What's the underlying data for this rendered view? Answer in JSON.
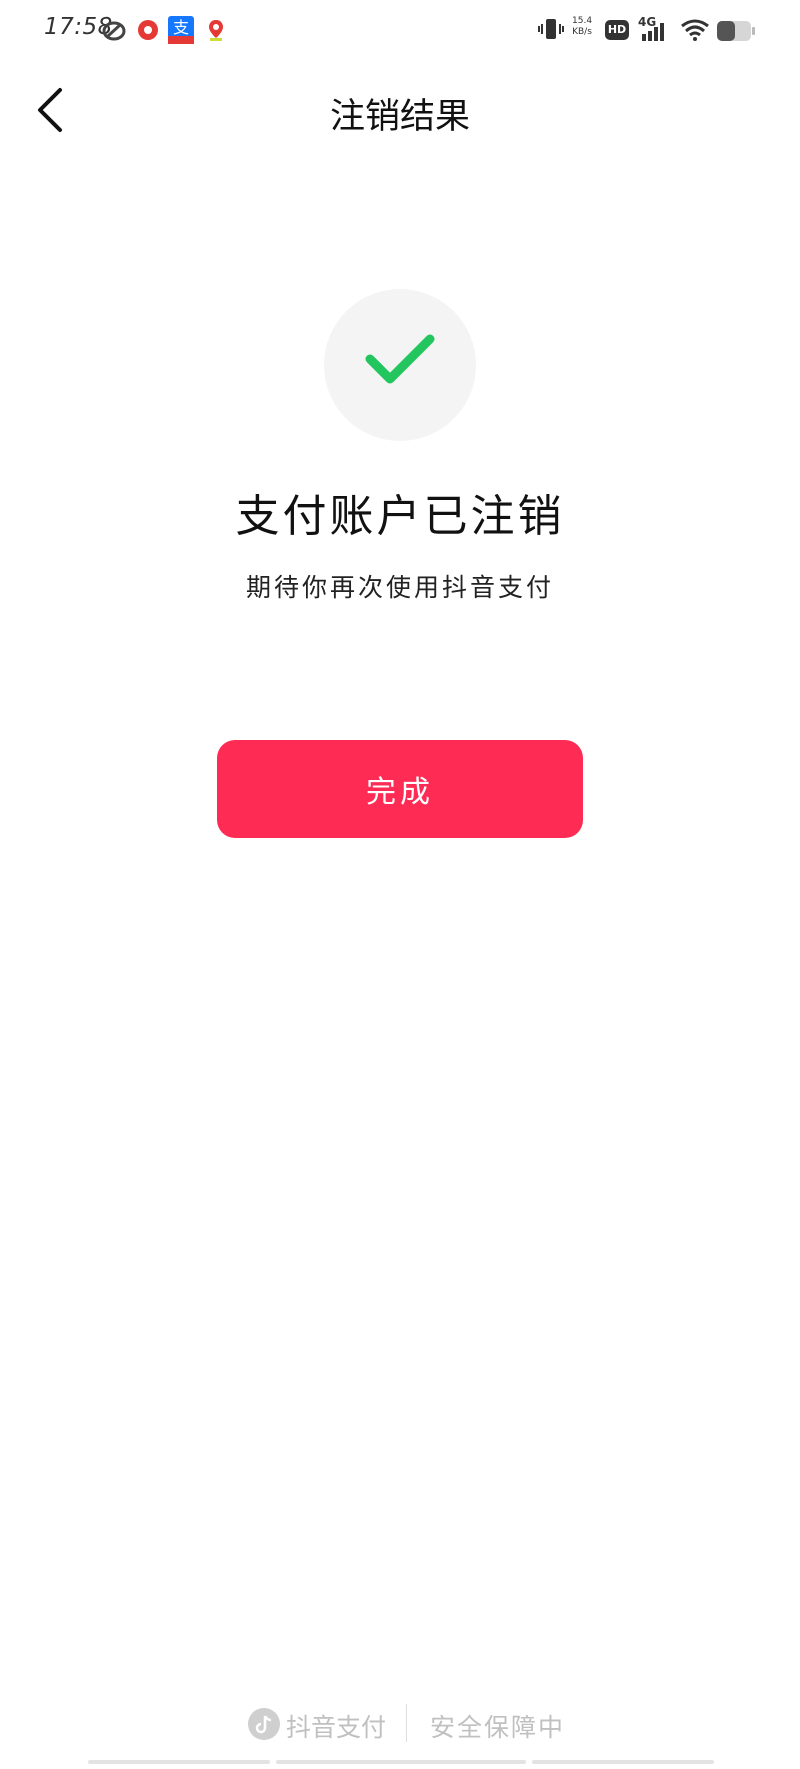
{
  "status_bar": {
    "time": "17:58",
    "net_speed_value": "15.4",
    "net_speed_unit": "KB/s",
    "hd": "HD",
    "network": "4G",
    "icons": [
      "weibo-icon",
      "record-icon",
      "alipay-icon",
      "map-pin-icon",
      "vibrate-icon",
      "signal-icon",
      "wifi-icon",
      "battery-icon"
    ]
  },
  "header": {
    "back_icon": "chevron-left-icon",
    "title": "注销结果"
  },
  "result": {
    "icon": "checkmark-icon",
    "title": "支付账户已注销",
    "subtitle": "期待你再次使用抖音支付"
  },
  "actions": {
    "done_label": "完成"
  },
  "footer": {
    "brand": "抖音支付",
    "secure_text": "安全保障中"
  },
  "colors": {
    "accent": "#fe2c55",
    "check": "#22c55e",
    "circle_bg": "#f4f4f4",
    "footer_text": "#c0c0c0"
  }
}
